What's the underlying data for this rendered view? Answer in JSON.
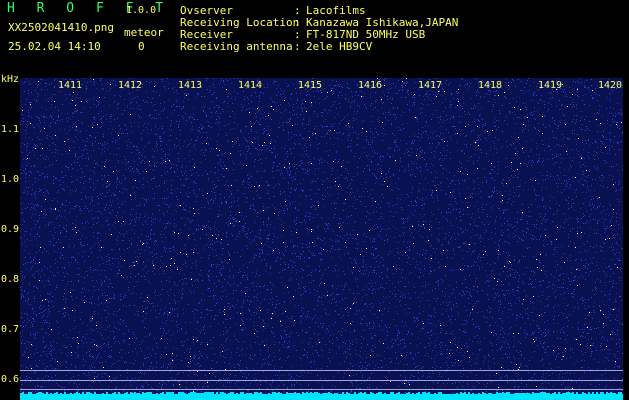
{
  "header": {
    "app_title": "H R O F F T",
    "version": "1.0.0",
    "filename": "XX2502041410.png",
    "meteor_label": "meteor",
    "datetime": "25.02.04 14:10",
    "meteor_count": "0",
    "info_labels": [
      "Ovserver",
      "Receiving Location",
      "Receiver",
      "Receiving antenna"
    ],
    "info_seps": [
      ":",
      ":",
      ":",
      ":"
    ],
    "info_values": [
      "Lacofilms",
      "Kanazawa Ishikawa,JAPAN",
      "FT-817ND 50MHz USB",
      "2ele HB9CV"
    ]
  },
  "spectrogram": {
    "y_unit": "kHz",
    "y_ticks": [
      "1.1",
      "1.0",
      "0.9",
      "0.8",
      "0.7",
      "0.6"
    ],
    "x_ticks": [
      "1411",
      "1412",
      "1413",
      "1414",
      "1415",
      "1416",
      "1417",
      "1418",
      "1419",
      "1420"
    ],
    "colors": {
      "background": "#0a1150",
      "noise": "#3344dd",
      "bright": "#ffffff",
      "baseline": "#00e5ff",
      "guide": "#c8c8ff"
    }
  }
}
